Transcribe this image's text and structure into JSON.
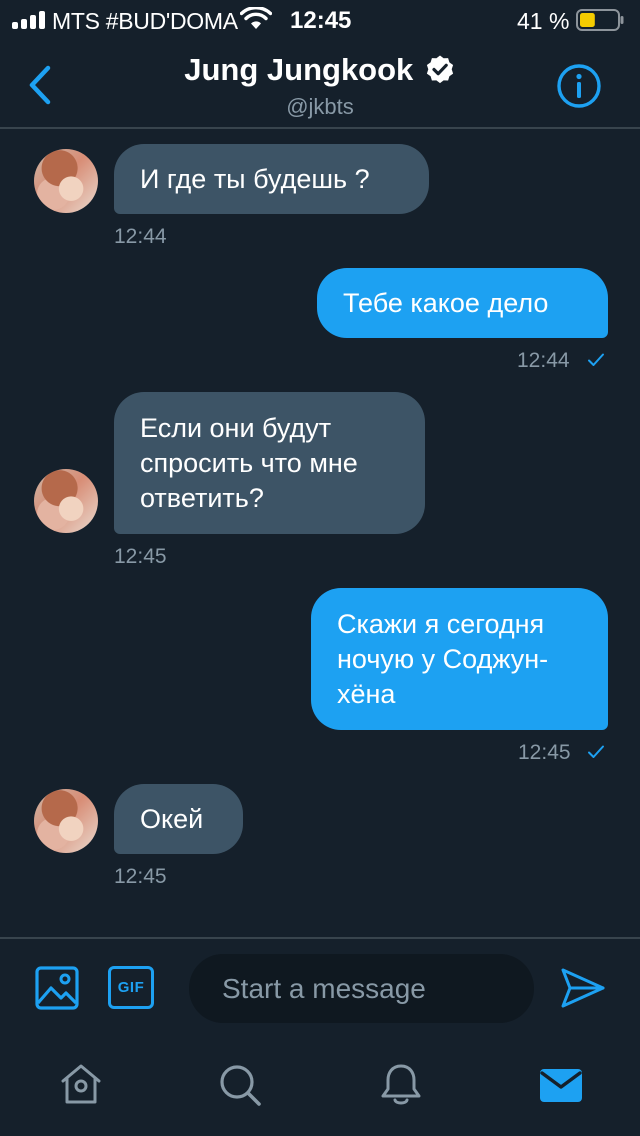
{
  "status_bar": {
    "carrier": "MTS #BUD'DOMA",
    "time": "12:45",
    "battery_percent": "41 %",
    "battery_level": 0.41
  },
  "header": {
    "name": "Jung Jungkook",
    "handle": "@jkbts",
    "back_icon": "chevron-left-icon",
    "info_icon": "info-icon"
  },
  "messages": [
    {
      "direction": "received",
      "lines": [
        "И где ты будешь ?"
      ],
      "time": "12:44"
    },
    {
      "direction": "sent",
      "lines": [
        "Тебе какое дело"
      ],
      "time": "12:44",
      "status": "read"
    },
    {
      "direction": "received",
      "lines": [
        "Если они будут",
        "спросить что мне",
        "ответить?"
      ],
      "time": "12:45"
    },
    {
      "direction": "sent",
      "lines": [
        "Скажи я сегодня",
        "ночую у Соджун-",
        "хёна"
      ],
      "time": "12:45",
      "status": "read"
    },
    {
      "direction": "received",
      "lines": [
        "Окей"
      ],
      "time": "12:45"
    }
  ],
  "composer": {
    "placeholder": "Start a message",
    "value": "",
    "gif_label": "GIF",
    "media_icon": "image-icon",
    "send_icon": "send-icon"
  },
  "tab_bar": {
    "items": [
      {
        "icon": "home-icon",
        "active": false
      },
      {
        "icon": "search-icon",
        "active": false
      },
      {
        "icon": "bell-icon",
        "active": false
      },
      {
        "icon": "mail-icon",
        "active": true
      }
    ]
  },
  "colors": {
    "background": "#15202b",
    "accent": "#1da1f2",
    "received_bubble": "#3d5466",
    "secondary_text": "#8899a6",
    "divider": "#38444d",
    "battery_fill": "#f5cc00"
  }
}
